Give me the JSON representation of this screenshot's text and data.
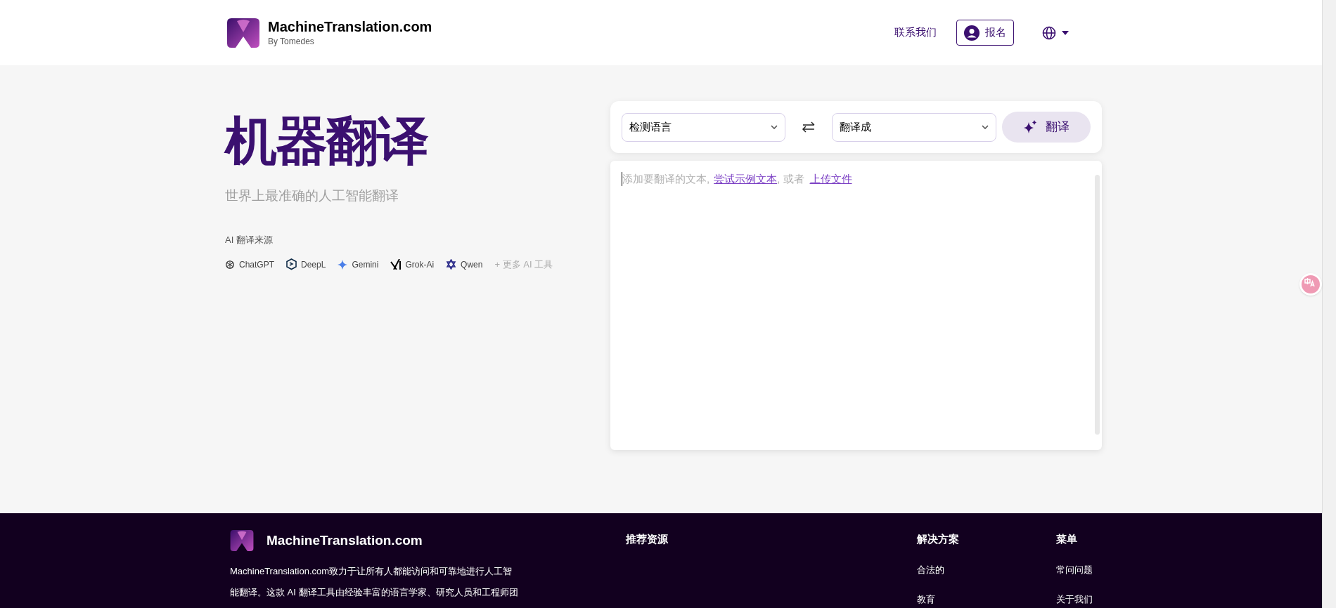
{
  "header": {
    "brand": "MachineTranslation.com",
    "byline": "By Tomedes",
    "contact_link": "联系我们",
    "signup_button": "报名"
  },
  "hero": {
    "title": "机器翻译",
    "subtitle": "世界上最准确的人工智能翻译",
    "sources_label": "AI 翻译来源",
    "sources": [
      {
        "kind": "chatgpt",
        "name": "ChatGPT"
      },
      {
        "kind": "deepl",
        "name": "DeepL"
      },
      {
        "kind": "gemini",
        "name": "Gemini"
      },
      {
        "kind": "grok",
        "name": "Grok-Ai"
      },
      {
        "kind": "qwen",
        "name": "Qwen"
      }
    ],
    "more_link": "+ 更多 AI 工具"
  },
  "translator": {
    "source_language": "检测语言",
    "target_language": "翻译成",
    "translate_button": "翻译",
    "hint": {
      "text": "添加要翻译的文本,",
      "sample_link": "尝试示例文本",
      "middle": ", 或者",
      "upload_link": "上传文件"
    }
  },
  "footer": {
    "brand": "MachineTranslation.com",
    "description_lines": [
      "MachineTranslation.com致力于让所有人都能访问和可靠地进行人工智",
      "能翻译。这款 AI 翻译工具由经验丰富的语言学家、研究人员和工程师团"
    ],
    "columns": [
      {
        "heading": "推荐资源"
      },
      {
        "heading": "解决方案",
        "links": [
          "合法的",
          "教育"
        ]
      },
      {
        "heading": "菜单",
        "links": [
          "常问问题",
          "关于我们"
        ]
      }
    ]
  }
}
